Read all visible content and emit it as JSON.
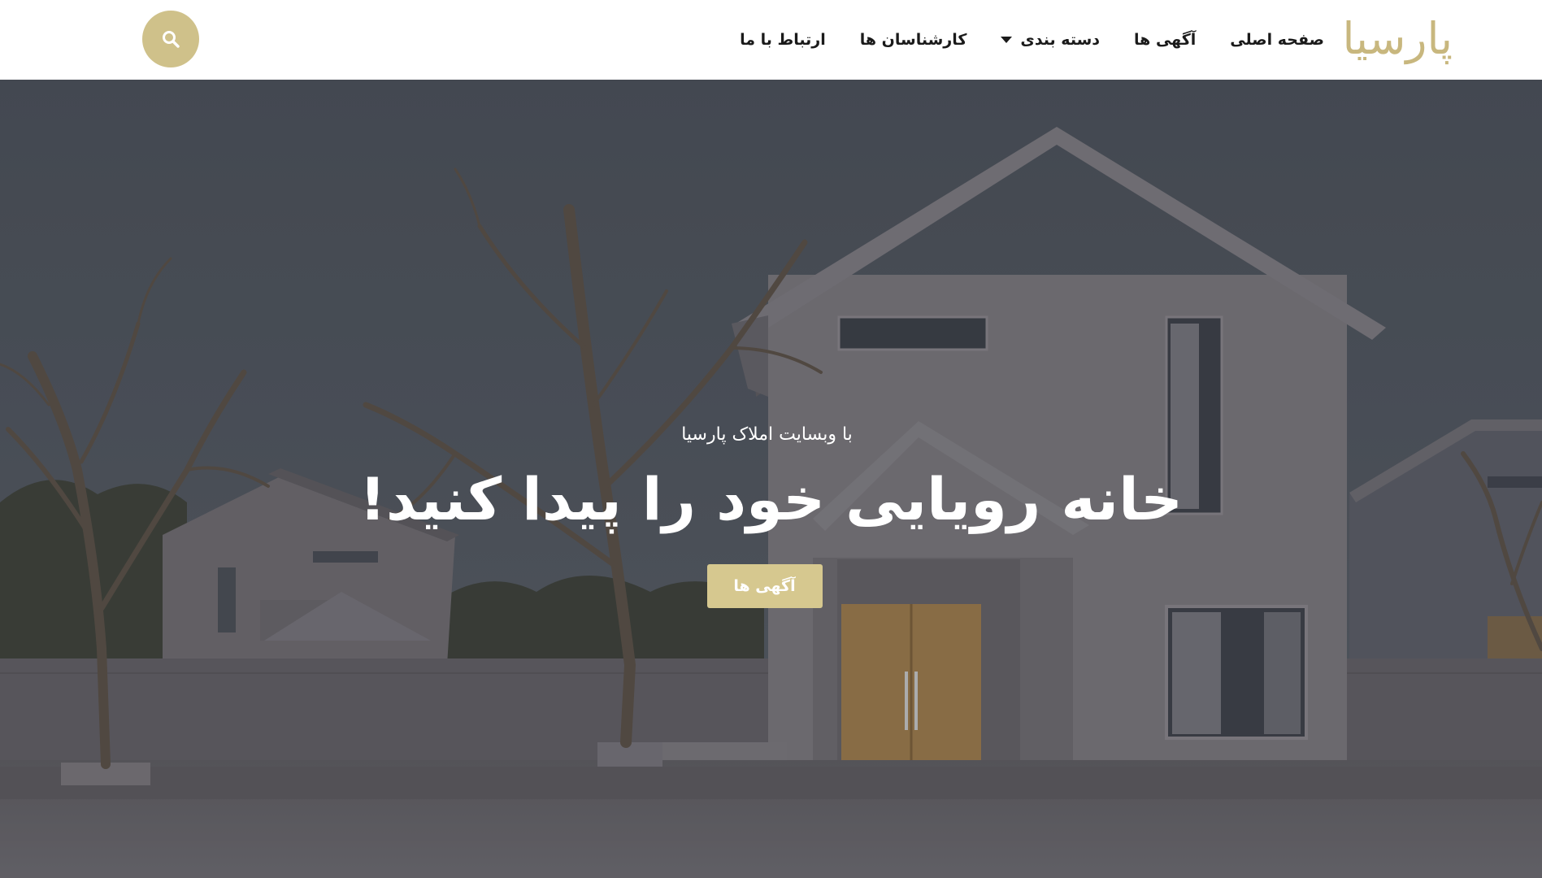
{
  "brand": {
    "logo_text": "پارسیا",
    "accent_color": "#cfc18a"
  },
  "nav": {
    "items": [
      {
        "label": "صفحه اصلی"
      },
      {
        "label": "آگهی ها"
      },
      {
        "label": "دسته بندی",
        "has_dropdown": true
      },
      {
        "label": "کارشناسان ها"
      },
      {
        "label": "ارتباط با ما"
      }
    ]
  },
  "search": {
    "icon": "search-icon"
  },
  "hero": {
    "subtitle": "با وبسایت املاک پارسیا",
    "title": "خانه رویایی خود را پیدا کنید!",
    "cta_label": "آگهی ها",
    "image": "house-with-bare-trees"
  }
}
